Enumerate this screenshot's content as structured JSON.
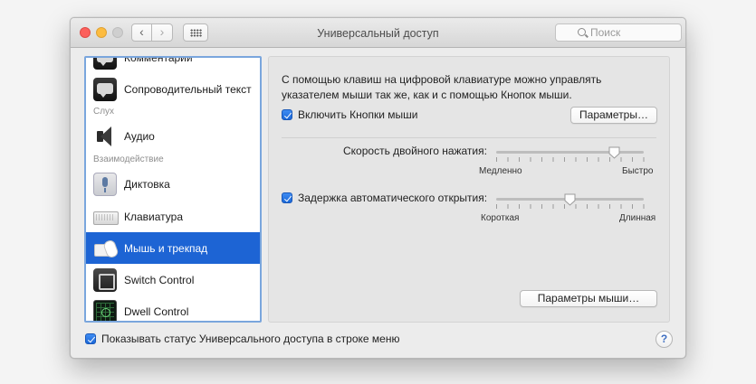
{
  "window": {
    "title": "Универсальный доступ",
    "search_placeholder": "Поиск"
  },
  "sidebar": {
    "top_partial_label": "Комментарии",
    "items": [
      {
        "label": "Сопроводительный текст",
        "icon": "captions-icon"
      },
      {
        "label": "Аудио",
        "icon": "speaker-icon"
      },
      {
        "label": "Диктовка",
        "icon": "microphone-icon"
      },
      {
        "label": "Клавиатура",
        "icon": "keyboard-icon"
      },
      {
        "label": "Мышь и трекпад",
        "icon": "mouse-trackpad-icon",
        "selected": true
      },
      {
        "label": "Switch Control",
        "icon": "switch-control-icon"
      },
      {
        "label": "Dwell Control",
        "icon": "dwell-control-icon"
      }
    ],
    "sections": {
      "hearing": "Слух",
      "interaction": "Взаимодействие"
    }
  },
  "panel": {
    "description": "С помощью клавиш на цифровой клавиатуре можно управлять указателем мыши так же, как и с помощью Кнопок мыши.",
    "mouse_keys": {
      "label": "Включить Кнопки мыши",
      "checked": true
    },
    "options_button": "Параметры…",
    "double_click": {
      "label": "Скорость двойного нажатия:",
      "min_label": "Медленно",
      "max_label": "Быстро",
      "value": 0.8
    },
    "spring_loading": {
      "label": "Задержка автоматического открытия:",
      "checked": true,
      "min_label": "Короткая",
      "max_label": "Длинная",
      "value": 0.5
    },
    "mouse_options_button": "Параметры мыши…"
  },
  "footer": {
    "show_status": {
      "label": "Показывать статус Универсального доступа в строке меню",
      "checked": true
    },
    "help_label": "?"
  },
  "colors": {
    "selection": "#1d64d4",
    "checkbox": "#2a76e6",
    "focus_ring": "#7aa6dd"
  }
}
